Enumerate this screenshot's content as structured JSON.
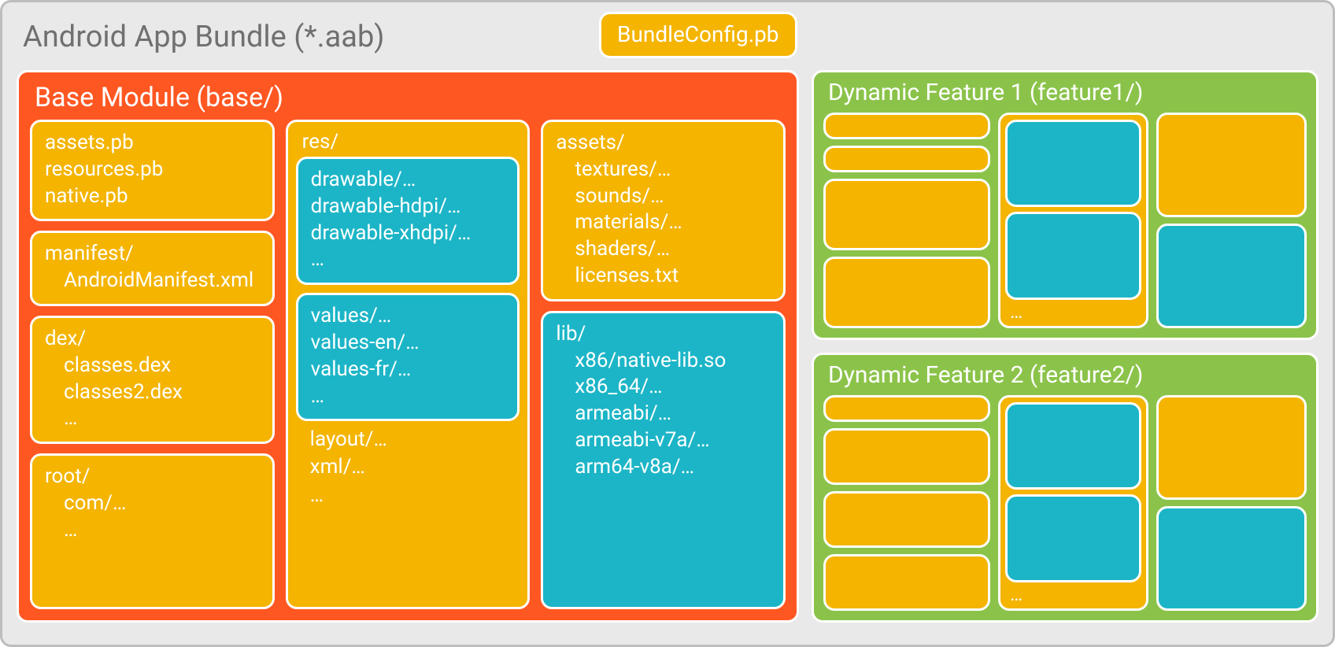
{
  "title": "Android App Bundle (*.aab)",
  "bundle_config": "BundleConfig.pb",
  "base": {
    "title": "Base Module (base/)",
    "col1": {
      "pb": [
        "assets.pb",
        "resources.pb",
        "native.pb"
      ],
      "manifest_hdr": "manifest/",
      "manifest_item": "AndroidManifest.xml",
      "dex_hdr": "dex/",
      "dex_items": [
        "classes.dex",
        "classes2.dex",
        "…"
      ],
      "root_hdr": "root/",
      "root_items": [
        "com/…",
        "…"
      ]
    },
    "res": {
      "hdr": "res/",
      "drawable": [
        "drawable/…",
        "drawable-hdpi/…",
        "drawable-xhdpi/…",
        "…"
      ],
      "values": [
        "values/…",
        "values-en/…",
        "values-fr/…",
        "…"
      ],
      "after": [
        "layout/…",
        "xml/…",
        "…"
      ]
    },
    "col3": {
      "assets_hdr": "assets/",
      "assets_items": [
        "textures/…",
        "sounds/…",
        "materials/…",
        "shaders/…",
        "licenses.txt"
      ],
      "lib_hdr": "lib/",
      "lib_items": [
        "x86/native-lib.so",
        "x86_64/…",
        "armeabi/…",
        "armeabi-v7a/…",
        "arm64-v8a/…"
      ]
    }
  },
  "features": [
    {
      "title": "Dynamic Feature 1 (feature1/)",
      "dots": "…"
    },
    {
      "title": "Dynamic Feature 2 (feature2/)",
      "dots": "…"
    }
  ]
}
